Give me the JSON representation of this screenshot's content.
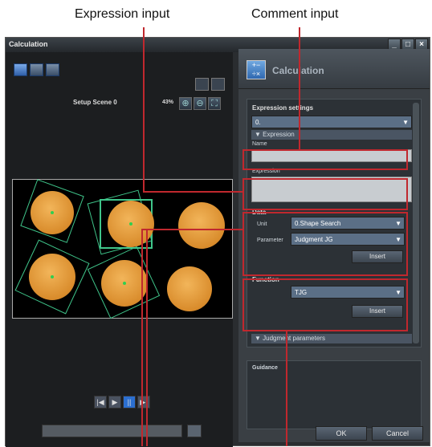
{
  "callouts": {
    "expression_input": "Expression input",
    "comment_input": "Comment input"
  },
  "window": {
    "title": "Calculation",
    "controls": [
      "_",
      "□",
      "×"
    ]
  },
  "viewer": {
    "scene_label": "Setup Scene 0",
    "zoom_level": "43%"
  },
  "panel": {
    "title": "Calculation",
    "expression_settings_label": "Expression settings",
    "expression_select_value": "0.",
    "expression_section": "▼ Expression",
    "name_label": "Name",
    "expression_label": "Expression",
    "data_label": "Data",
    "unit_label": "Unit",
    "unit_value": "0.Shape Search",
    "parameter_label": "Parameter",
    "parameter_value": "Judgment JG",
    "data_insert": "Insert",
    "function_label": "Function",
    "function_value": "TJG",
    "function_insert": "Insert",
    "judgment_section": "▼ Judgment parameters",
    "guidance_label": "Guidance",
    "ok": "OK",
    "cancel": "Cancel"
  },
  "colors": {
    "callout_line": "#c0282e",
    "selection_box": "#3fc58a"
  }
}
